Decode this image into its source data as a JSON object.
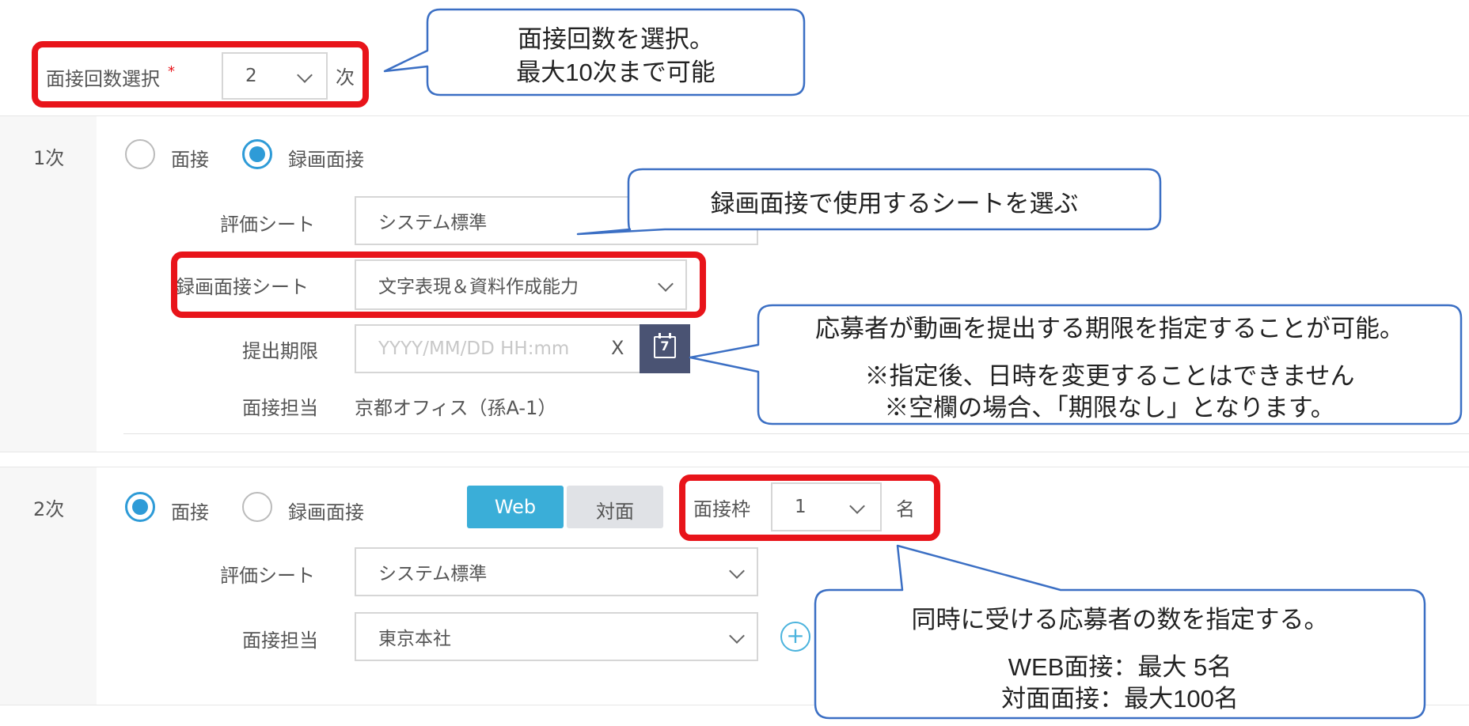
{
  "top": {
    "count_label": "面接回数選択",
    "required_mark": "*",
    "count_value": "2",
    "count_suffix": "次"
  },
  "stage1": {
    "title": "1次",
    "radio_interview": "面接",
    "radio_recorded": "録画面接",
    "selected": "録画面接",
    "eval_sheet_label": "評価シート",
    "eval_sheet_value": "システム標準",
    "recorded_sheet_label": "録画面接シート",
    "recorded_sheet_value": "文字表現＆資料作成能力",
    "deadline_label": "提出期限",
    "deadline_placeholder": "YYYY/MM/DD HH:mm",
    "deadline_clear": "X",
    "calendar_day": "7",
    "person_label": "面接担当",
    "person_value": "京都オフィス（孫A-1）"
  },
  "stage2": {
    "title": "2次",
    "radio_interview": "面接",
    "radio_recorded": "録画面接",
    "selected": "面接",
    "mode_web": "Web",
    "mode_face": "対面",
    "slot_label": "面接枠",
    "slot_value": "1",
    "slot_suffix": "名",
    "eval_sheet_label": "評価シート",
    "eval_sheet_value": "システム標準",
    "person_label": "面接担当",
    "person_value": "東京本社",
    "add_symbol": "+"
  },
  "callouts": {
    "c1_line1": "面接回数を選択。",
    "c1_line2": "最大10次まで可能",
    "c2_line1": "録画面接で使用するシートを選ぶ",
    "c3_line1": "応募者が動画を提出する期限を指定することが可能。",
    "c3_line2": "※指定後、日時を変更することはできません",
    "c3_line3": "※空欄の場合、「期限なし」となります。",
    "c4_line1": "同時に受ける応募者の数を指定する。",
    "c4_line2": "WEB面接：最大 5名",
    "c4_line3": "対面面接：最大100名"
  },
  "colors": {
    "accent_blue": "#2e9bd7",
    "highlight_red": "#e8141a",
    "callout_border": "#3b6fc4",
    "web_button": "#3aaed8",
    "calendar_button": "#4a5373"
  }
}
